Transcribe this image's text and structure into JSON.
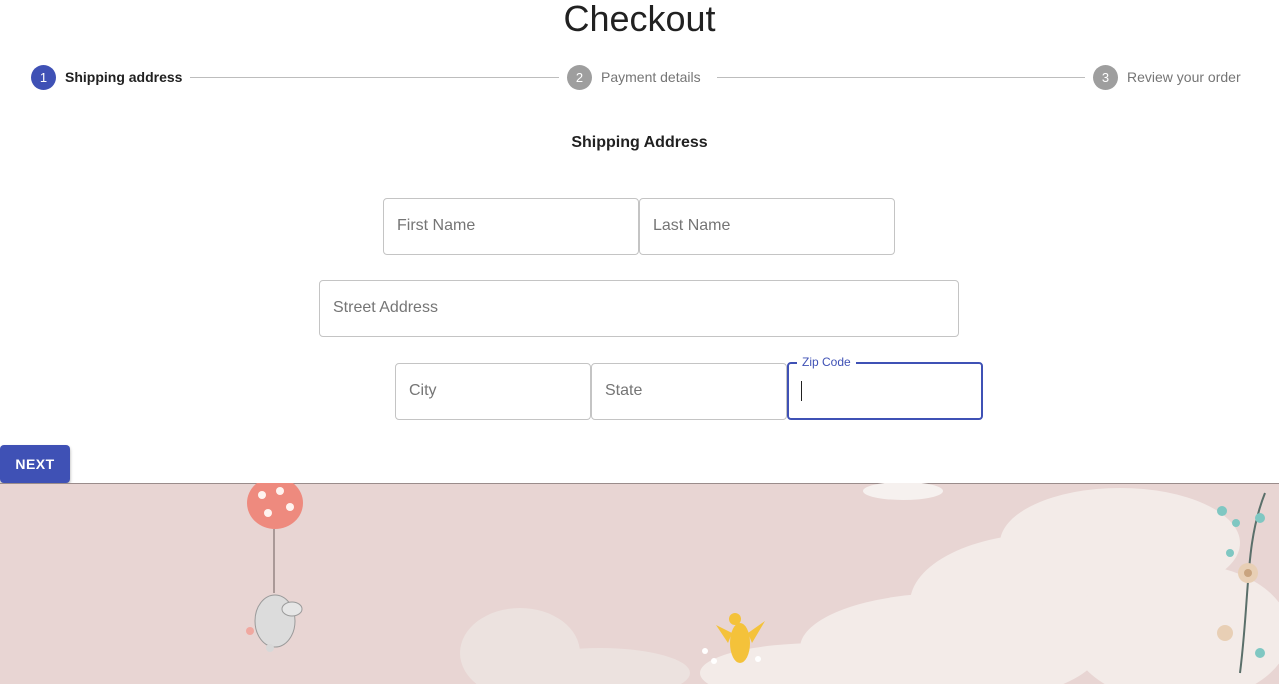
{
  "page": {
    "title": "Checkout"
  },
  "stepper": {
    "steps": [
      {
        "number": "1",
        "label": "Shipping address",
        "active": true
      },
      {
        "number": "2",
        "label": "Payment details",
        "active": false
      },
      {
        "number": "3",
        "label": "Review your order",
        "active": false
      }
    ]
  },
  "form": {
    "section_title": "Shipping Address",
    "first_name": {
      "placeholder": "First Name",
      "value": ""
    },
    "last_name": {
      "placeholder": "Last Name",
      "value": ""
    },
    "street": {
      "placeholder": "Street Address",
      "value": ""
    },
    "city": {
      "placeholder": "City",
      "value": ""
    },
    "state": {
      "placeholder": "State",
      "value": ""
    },
    "zip": {
      "label": "Zip Code",
      "value": ""
    }
  },
  "actions": {
    "next_label": "NEXT"
  },
  "colors": {
    "primary": "#3f51b5",
    "inactive_step": "#9e9e9e",
    "banner_bg": "#e8d5d3"
  }
}
